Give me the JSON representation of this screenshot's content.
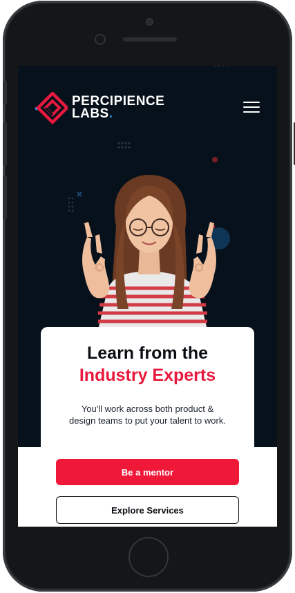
{
  "brand": {
    "line1": "PERCIPIENCE",
    "line2": "LABS",
    "dot": ".",
    "accent": "#e8193d",
    "dot_color": "#2b8fd6"
  },
  "nav": {
    "menu_icon": "hamburger-menu-icon"
  },
  "hero": {
    "title_line1": "Learn from the",
    "title_line2": "Industry Experts",
    "description": "You'll work across both product & design teams to put your talent to work.",
    "primary_button": "Be a mentor",
    "secondary_button": "Explore Services"
  },
  "colors": {
    "background": "#06111b",
    "primary": "#f01839",
    "text": "#0b0f14"
  }
}
